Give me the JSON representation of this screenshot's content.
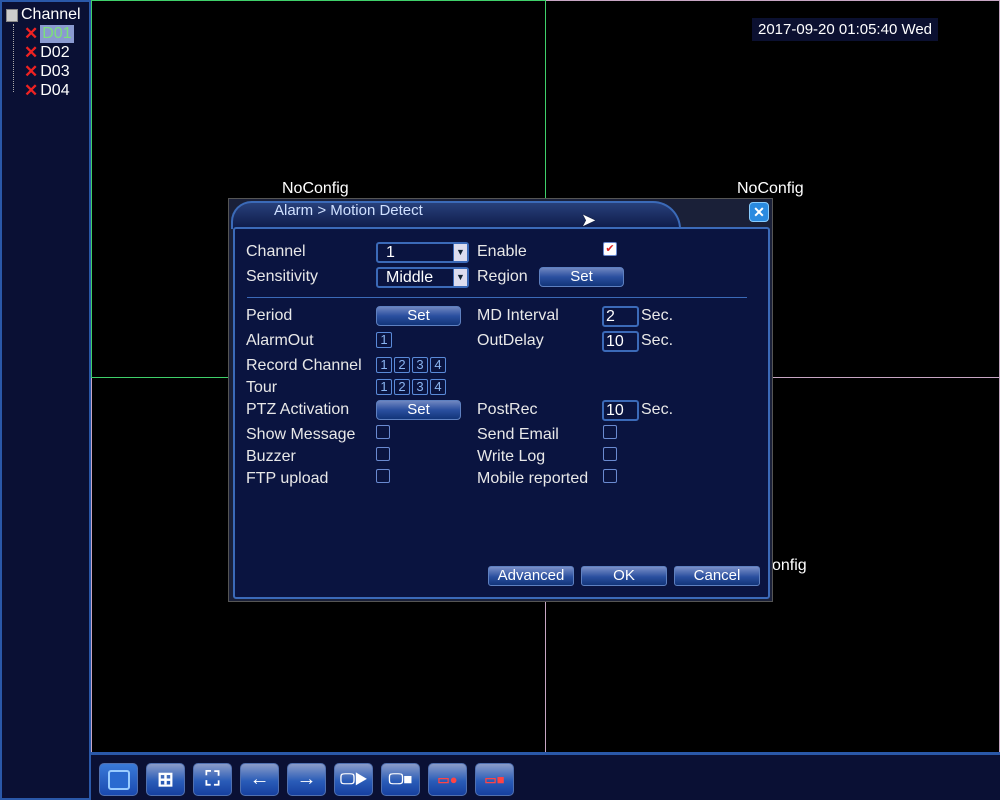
{
  "sidebar": {
    "title": "Channel",
    "channels": [
      "D01",
      "D02",
      "D03",
      "D04"
    ],
    "selected": "D01"
  },
  "clock": "2017-09-20 01:05:40 Wed",
  "video": {
    "noconfig": "NoConfig",
    "noconfig_partial": "onfig"
  },
  "dialog": {
    "title": "Alarm > Motion Detect",
    "channel": {
      "label": "Channel",
      "value": "1"
    },
    "sensitivity": {
      "label": "Sensitivity",
      "value": "Middle"
    },
    "enable": {
      "label": "Enable",
      "checked": true
    },
    "region": {
      "label": "Region",
      "button": "Set"
    },
    "period": {
      "label": "Period",
      "button": "Set"
    },
    "md_interval": {
      "label": "MD Interval",
      "value": "2",
      "unit": "Sec."
    },
    "alarm_out": {
      "label": "AlarmOut",
      "channels": [
        "1"
      ]
    },
    "out_delay": {
      "label": "OutDelay",
      "value": "10",
      "unit": "Sec."
    },
    "record_channel": {
      "label": "Record Channel",
      "channels": [
        "1",
        "2",
        "3",
        "4"
      ]
    },
    "tour": {
      "label": "Tour",
      "channels": [
        "1",
        "2",
        "3",
        "4"
      ]
    },
    "ptz": {
      "label": "PTZ Activation",
      "button": "Set"
    },
    "postrec": {
      "label": "PostRec",
      "value": "10",
      "unit": "Sec."
    },
    "show_message": {
      "label": "Show Message",
      "checked": false
    },
    "send_email": {
      "label": "Send Email",
      "checked": false
    },
    "buzzer": {
      "label": "Buzzer",
      "checked": false
    },
    "write_log": {
      "label": "Write Log",
      "checked": false
    },
    "ftp_upload": {
      "label": "FTP upload",
      "checked": false
    },
    "mobile_reported": {
      "label": "Mobile reported",
      "checked": false
    },
    "buttons": {
      "advanced": "Advanced",
      "ok": "OK",
      "cancel": "Cancel"
    }
  },
  "toolbar": [
    "single-view-icon",
    "quad-view-icon",
    "fullscreen-icon",
    "arrow-left-icon",
    "arrow-right-icon",
    "start-tour-icon",
    "stop-tour-icon",
    "start-record-icon",
    "stop-record-icon"
  ]
}
